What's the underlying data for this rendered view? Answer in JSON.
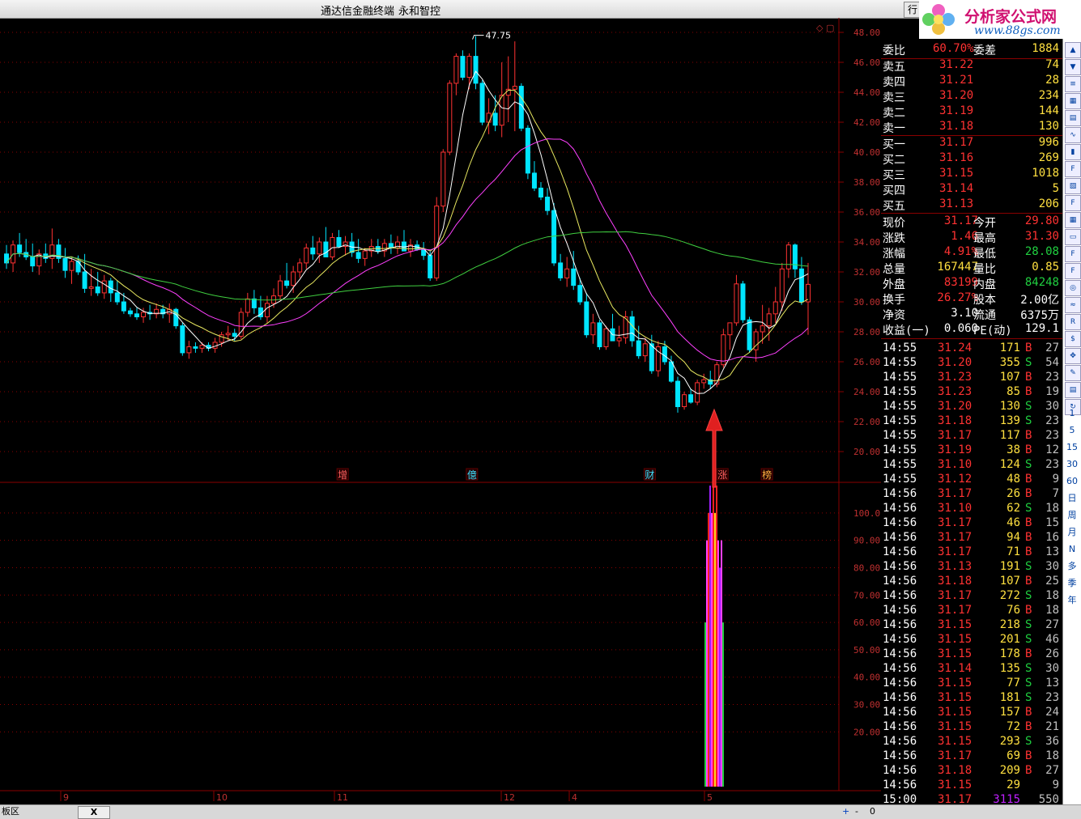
{
  "window": {
    "title": "通达信金融终端",
    "subtitle": "永和智控",
    "menu_button": "行"
  },
  "logo": {
    "name": "分析家公式网",
    "url": "www.88gs.com"
  },
  "price_axis": [
    "48.00",
    "46.00",
    "44.00",
    "42.00",
    "40.00",
    "38.00",
    "36.00",
    "34.00",
    "32.00",
    "30.00",
    "28.00",
    "26.00",
    "24.00",
    "22.00",
    "20.00"
  ],
  "indicator_axis": [
    "100.0",
    "90.00",
    "80.00",
    "70.00",
    "60.00",
    "50.00",
    "40.00",
    "30.00",
    "20.00"
  ],
  "date_labels": [
    "9",
    "10",
    "11",
    "12",
    "4",
    "5"
  ],
  "max_label": "47.75",
  "event_markers": [
    "增",
    "億",
    "财",
    "涨",
    "榜"
  ],
  "quote": {
    "wei_bi": {
      "label": "委比",
      "value": "60.70%",
      "label2": "委差",
      "value2": "1884"
    },
    "asks": [
      {
        "label": "卖五",
        "price": "31.22",
        "vol": "74"
      },
      {
        "label": "卖四",
        "price": "31.21",
        "vol": "28"
      },
      {
        "label": "卖三",
        "price": "31.20",
        "vol": "234"
      },
      {
        "label": "卖二",
        "price": "31.19",
        "vol": "144"
      },
      {
        "label": "卖一",
        "price": "31.18",
        "vol": "130"
      }
    ],
    "bids": [
      {
        "label": "买一",
        "price": "31.17",
        "vol": "996"
      },
      {
        "label": "买二",
        "price": "31.16",
        "vol": "269"
      },
      {
        "label": "买三",
        "price": "31.15",
        "vol": "1018"
      },
      {
        "label": "买四",
        "price": "31.14",
        "vol": "5"
      },
      {
        "label": "买五",
        "price": "31.13",
        "vol": "206"
      }
    ],
    "stats": [
      {
        "l1": "现价",
        "v1": "31.17",
        "l2": "今开",
        "v2": "29.80"
      },
      {
        "l1": "涨跌",
        "v1": "1.46",
        "l2": "最高",
        "v2": "31.30"
      },
      {
        "l1": "涨幅",
        "v1": "4.91%",
        "l2": "最低",
        "v2": "28.08"
      },
      {
        "l1": "总量",
        "v1": "167447",
        "l2": "量比",
        "v2": "0.85"
      },
      {
        "l1": "外盘",
        "v1": "83199",
        "l2": "内盘",
        "v2": "84248"
      },
      {
        "l1": "换手",
        "v1": "26.27%",
        "l2": "股本",
        "v2": "2.00亿"
      },
      {
        "l1": "净资",
        "v1": "3.10",
        "l2": "流通",
        "v2": "6375万"
      },
      {
        "l1": "收益(一)",
        "v1": "0.060",
        "l2": "PE(动)",
        "v2": "129.1"
      }
    ]
  },
  "ticks": [
    {
      "time": "14:55",
      "price": "31.24",
      "vol": "171",
      "dir": "B",
      "n": "27"
    },
    {
      "time": "14:55",
      "price": "31.20",
      "vol": "355",
      "dir": "S",
      "n": "54"
    },
    {
      "time": "14:55",
      "price": "31.23",
      "vol": "107",
      "dir": "B",
      "n": "23"
    },
    {
      "time": "14:55",
      "price": "31.23",
      "vol": "85",
      "dir": "B",
      "n": "19"
    },
    {
      "time": "14:55",
      "price": "31.20",
      "vol": "130",
      "dir": "S",
      "n": "30"
    },
    {
      "time": "14:55",
      "price": "31.18",
      "vol": "139",
      "dir": "S",
      "n": "23"
    },
    {
      "time": "14:55",
      "price": "31.17",
      "vol": "117",
      "dir": "B",
      "n": "23"
    },
    {
      "time": "14:55",
      "price": "31.19",
      "vol": "38",
      "dir": "B",
      "n": "12"
    },
    {
      "time": "14:55",
      "price": "31.10",
      "vol": "124",
      "dir": "S",
      "n": "23"
    },
    {
      "time": "14:55",
      "price": "31.12",
      "vol": "48",
      "dir": "B",
      "n": "9"
    },
    {
      "time": "14:56",
      "price": "31.17",
      "vol": "26",
      "dir": "B",
      "n": "7"
    },
    {
      "time": "14:56",
      "price": "31.10",
      "vol": "62",
      "dir": "S",
      "n": "18"
    },
    {
      "time": "14:56",
      "price": "31.17",
      "vol": "46",
      "dir": "B",
      "n": "15"
    },
    {
      "time": "14:56",
      "price": "31.17",
      "vol": "94",
      "dir": "B",
      "n": "16"
    },
    {
      "time": "14:56",
      "price": "31.17",
      "vol": "71",
      "dir": "B",
      "n": "13"
    },
    {
      "time": "14:56",
      "price": "31.13",
      "vol": "191",
      "dir": "S",
      "n": "30"
    },
    {
      "time": "14:56",
      "price": "31.18",
      "vol": "107",
      "dir": "B",
      "n": "25"
    },
    {
      "time": "14:56",
      "price": "31.17",
      "vol": "272",
      "dir": "S",
      "n": "18"
    },
    {
      "time": "14:56",
      "price": "31.17",
      "vol": "76",
      "dir": "B",
      "n": "18"
    },
    {
      "time": "14:56",
      "price": "31.15",
      "vol": "218",
      "dir": "S",
      "n": "27"
    },
    {
      "time": "14:56",
      "price": "31.15",
      "vol": "201",
      "dir": "S",
      "n": "46"
    },
    {
      "time": "14:56",
      "price": "31.15",
      "vol": "178",
      "dir": "B",
      "n": "26"
    },
    {
      "time": "14:56",
      "price": "31.14",
      "vol": "135",
      "dir": "S",
      "n": "30"
    },
    {
      "time": "14:56",
      "price": "31.15",
      "vol": "77",
      "dir": "S",
      "n": "13"
    },
    {
      "time": "14:56",
      "price": "31.15",
      "vol": "181",
      "dir": "S",
      "n": "23"
    },
    {
      "time": "14:56",
      "price": "31.15",
      "vol": "157",
      "dir": "B",
      "n": "24"
    },
    {
      "time": "14:56",
      "price": "31.15",
      "vol": "72",
      "dir": "B",
      "n": "21"
    },
    {
      "time": "14:56",
      "price": "31.15",
      "vol": "293",
      "dir": "S",
      "n": "36"
    },
    {
      "time": "14:56",
      "price": "31.17",
      "vol": "69",
      "dir": "B",
      "n": "18"
    },
    {
      "time": "14:56",
      "price": "31.18",
      "vol": "209",
      "dir": "B",
      "n": "27"
    },
    {
      "time": "14:56",
      "price": "31.15",
      "vol": "29",
      "dir": "",
      "n": "9"
    },
    {
      "time": "15:00",
      "price": "31.17",
      "vol": "3115",
      "dir": "",
      "n": "550"
    }
  ],
  "toolbar": {
    "icons": [
      "arrow-up-icon",
      "arrow-down-icon",
      "list-icon",
      "grid-icon",
      "table-icon",
      "line-chart-icon",
      "candle-icon",
      "f10-icon",
      "fig-icon",
      "f9-icon",
      "grid2-icon",
      "doc-icon",
      "fz-icon",
      "fa-icon",
      "target-icon",
      "wave-icon",
      "rsi-icon",
      "money-icon",
      "move-icon",
      "pen-icon",
      "book-icon",
      "refresh-icon"
    ],
    "periods": [
      "1",
      "5",
      "15",
      "30",
      "60",
      "日",
      "周",
      "月",
      "N",
      "多",
      "季",
      "年"
    ]
  },
  "bottombar": {
    "tab_label": "板区",
    "close": "X",
    "plus": "+",
    "minus": "-",
    "zero": "0"
  },
  "colors": {
    "up": "#ff3232",
    "down": "#00e5ff",
    "ma5": "#ffffff",
    "ma10": "#e8e860",
    "ma20": "#ff40ff",
    "ma60": "#40d040",
    "grid": "#8a0000"
  },
  "chart_data": {
    "type": "candlestick",
    "price_range": [
      20,
      48
    ],
    "candles": [
      [
        33.2,
        33.8,
        32.2,
        32.6
      ],
      [
        32.6,
        34.1,
        32.0,
        33.8
      ],
      [
        33.8,
        34.6,
        33.0,
        33.3
      ],
      [
        33.3,
        34.2,
        32.8,
        33.0
      ],
      [
        33.0,
        33.9,
        32.0,
        32.4
      ],
      [
        32.4,
        33.5,
        31.8,
        33.2
      ],
      [
        33.2,
        33.9,
        32.6,
        32.9
      ],
      [
        32.9,
        34.9,
        32.2,
        33.8
      ],
      [
        33.8,
        34.2,
        32.6,
        32.9
      ],
      [
        32.9,
        33.6,
        31.6,
        32.1
      ],
      [
        32.1,
        33.0,
        31.2,
        32.7
      ],
      [
        32.7,
        33.1,
        31.8,
        32.0
      ],
      [
        32.0,
        33.2,
        30.6,
        30.9
      ],
      [
        30.9,
        32.2,
        30.4,
        31.0
      ],
      [
        31.0,
        32.0,
        30.4,
        30.6
      ],
      [
        30.6,
        31.8,
        30.2,
        31.4
      ],
      [
        31.4,
        31.6,
        30.0,
        30.6
      ],
      [
        30.6,
        31.4,
        29.8,
        30.0
      ],
      [
        30.0,
        30.6,
        29.2,
        29.4
      ],
      [
        29.4,
        29.6,
        29.0,
        29.2
      ],
      [
        29.2,
        29.6,
        28.8,
        29.0
      ],
      [
        29.0,
        29.6,
        28.6,
        29.3
      ],
      [
        29.3,
        29.8,
        28.8,
        29.2
      ],
      [
        29.2,
        29.9,
        28.9,
        29.5
      ],
      [
        29.5,
        29.8,
        28.9,
        29.2
      ],
      [
        29.2,
        29.9,
        28.6,
        29.5
      ],
      [
        29.5,
        29.6,
        28.2,
        28.4
      ],
      [
        28.4,
        28.6,
        26.4,
        26.6
      ],
      [
        26.6,
        27.4,
        26.2,
        27.0
      ],
      [
        27.0,
        27.3,
        26.6,
        26.9
      ],
      [
        26.9,
        27.3,
        26.6,
        27.1
      ],
      [
        27.1,
        27.3,
        26.7,
        26.9
      ],
      [
        26.9,
        27.6,
        26.6,
        27.3
      ],
      [
        27.3,
        28.0,
        27.0,
        27.8
      ],
      [
        27.8,
        28.4,
        27.4,
        27.9
      ],
      [
        27.9,
        28.2,
        27.4,
        27.7
      ],
      [
        27.7,
        29.6,
        27.5,
        29.3
      ],
      [
        29.3,
        30.6,
        29.0,
        30.2
      ],
      [
        30.2,
        30.8,
        29.2,
        29.6
      ],
      [
        29.6,
        30.4,
        28.8,
        29.0
      ],
      [
        29.0,
        30.4,
        28.6,
        29.9
      ],
      [
        29.9,
        30.9,
        29.6,
        30.4
      ],
      [
        30.4,
        31.8,
        30.1,
        31.4
      ],
      [
        31.4,
        32.6,
        30.9,
        31.1
      ],
      [
        31.1,
        32.4,
        30.6,
        32.0
      ],
      [
        32.0,
        32.9,
        31.6,
        32.6
      ],
      [
        32.6,
        33.9,
        32.2,
        33.6
      ],
      [
        33.6,
        34.4,
        32.8,
        33.2
      ],
      [
        33.2,
        34.3,
        32.6,
        34.0
      ],
      [
        34.0,
        35.0,
        33.4,
        33.0
      ],
      [
        33.0,
        34.6,
        32.8,
        34.3
      ],
      [
        34.3,
        34.8,
        33.6,
        33.7
      ],
      [
        33.7,
        34.4,
        33.1,
        34.0
      ],
      [
        34.0,
        34.6,
        33.0,
        33.3
      ],
      [
        33.3,
        34.2,
        32.6,
        32.9
      ],
      [
        32.9,
        33.6,
        32.4,
        33.4
      ],
      [
        33.4,
        34.2,
        33.0,
        33.7
      ],
      [
        33.7,
        34.2,
        33.2,
        33.4
      ],
      [
        33.4,
        34.2,
        33.0,
        33.9
      ],
      [
        33.9,
        34.5,
        33.2,
        33.6
      ],
      [
        33.6,
        34.4,
        33.2,
        34.0
      ],
      [
        34.0,
        34.8,
        33.4,
        33.4
      ],
      [
        33.4,
        34.2,
        33.0,
        33.8
      ],
      [
        33.8,
        34.1,
        33.4,
        33.5
      ],
      [
        33.5,
        34.0,
        32.8,
        33.1
      ],
      [
        33.1,
        33.4,
        31.4,
        31.6
      ],
      [
        31.6,
        37.0,
        31.4,
        36.4
      ],
      [
        36.4,
        40.2,
        36.0,
        40.0
      ],
      [
        40.0,
        44.8,
        39.8,
        44.6
      ],
      [
        44.6,
        46.6,
        43.8,
        46.4
      ],
      [
        46.4,
        46.8,
        44.8,
        45.0
      ],
      [
        45.0,
        46.6,
        44.2,
        46.4
      ],
      [
        46.4,
        47.75,
        44.2,
        44.6
      ],
      [
        44.6,
        44.8,
        41.8,
        42.0
      ],
      [
        42.0,
        43.6,
        41.2,
        42.6
      ],
      [
        42.6,
        43.8,
        41.4,
        41.8
      ],
      [
        41.8,
        46.0,
        41.0,
        43.8
      ],
      [
        43.8,
        46.4,
        42.0,
        44.2
      ],
      [
        44.2,
        47.4,
        41.4,
        44.4
      ],
      [
        44.4,
        44.6,
        41.4,
        41.6
      ],
      [
        41.6,
        41.8,
        38.2,
        38.6
      ],
      [
        38.6,
        39.4,
        37.4,
        37.6
      ],
      [
        37.6,
        38.0,
        36.8,
        37.0
      ],
      [
        37.0,
        37.6,
        35.8,
        36.1
      ],
      [
        36.1,
        36.6,
        32.4,
        32.6
      ],
      [
        32.6,
        33.2,
        31.4,
        31.6
      ],
      [
        31.6,
        33.0,
        31.0,
        32.2
      ],
      [
        32.2,
        33.4,
        30.8,
        31.1
      ],
      [
        31.1,
        31.6,
        29.8,
        30.0
      ],
      [
        30.0,
        30.6,
        27.6,
        27.8
      ],
      [
        27.8,
        29.2,
        27.2,
        28.6
      ],
      [
        28.6,
        28.8,
        26.8,
        27.0
      ],
      [
        27.0,
        28.4,
        26.8,
        28.2
      ],
      [
        28.2,
        29.2,
        27.4,
        27.4
      ],
      [
        27.4,
        28.4,
        27.0,
        27.6
      ],
      [
        27.6,
        29.4,
        27.2,
        29.0
      ],
      [
        29.0,
        29.4,
        27.0,
        27.4
      ],
      [
        27.4,
        28.4,
        26.2,
        26.4
      ],
      [
        26.4,
        27.6,
        26.0,
        27.2
      ],
      [
        27.2,
        27.8,
        25.2,
        25.4
      ],
      [
        25.4,
        27.4,
        25.0,
        27.0
      ],
      [
        27.0,
        27.4,
        25.8,
        26.0
      ],
      [
        26.0,
        26.4,
        24.6,
        24.7
      ],
      [
        24.7,
        25.0,
        22.6,
        23.0
      ],
      [
        23.0,
        24.0,
        22.8,
        23.8
      ],
      [
        23.8,
        24.2,
        23.2,
        23.3
      ],
      [
        23.3,
        24.8,
        23.1,
        24.6
      ],
      [
        24.6,
        25.2,
        24.2,
        24.8
      ],
      [
        24.8,
        25.4,
        24.2,
        24.5
      ],
      [
        24.5,
        26.0,
        24.3,
        25.8
      ],
      [
        25.8,
        28.2,
        25.6,
        27.8
      ],
      [
        27.8,
        28.6,
        26.8,
        28.6
      ],
      [
        28.6,
        31.8,
        28.4,
        31.2
      ],
      [
        31.2,
        31.4,
        28.6,
        28.8
      ],
      [
        28.8,
        29.0,
        26.6,
        26.8
      ],
      [
        26.8,
        28.2,
        26.0,
        28.0
      ],
      [
        28.0,
        29.8,
        27.2,
        28.4
      ],
      [
        28.4,
        29.6,
        27.4,
        29.2
      ],
      [
        29.2,
        31.0,
        28.6,
        30.0
      ],
      [
        30.0,
        32.6,
        29.4,
        32.2
      ],
      [
        32.2,
        34.0,
        31.6,
        33.8
      ],
      [
        33.8,
        33.9,
        31.6,
        32.2
      ],
      [
        32.2,
        33.0,
        29.8,
        30.0
      ],
      [
        30.0,
        32.6,
        27.8,
        31.17
      ]
    ]
  }
}
